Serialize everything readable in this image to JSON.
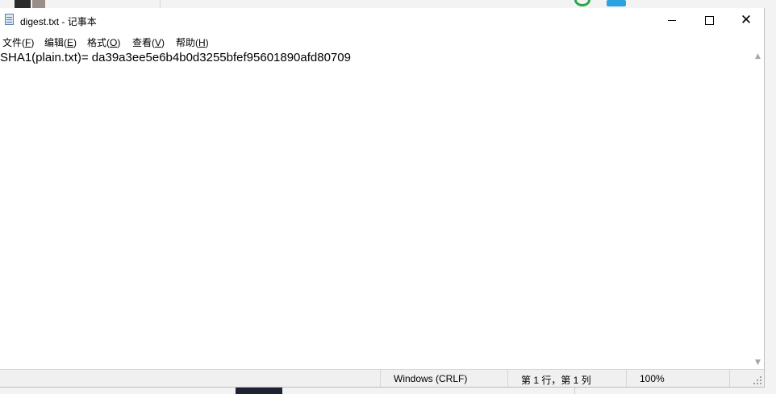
{
  "window": {
    "title": "digest.txt - 记事本",
    "minimize_glyph": "",
    "maximize_glyph": "",
    "close_glyph": "✕"
  },
  "menu": {
    "items": [
      {
        "label": "文件(",
        "accel": "F",
        "suffix": ")"
      },
      {
        "label": "编辑(",
        "accel": "E",
        "suffix": ")"
      },
      {
        "label": "格式(",
        "accel": "O",
        "suffix": ")"
      },
      {
        "label": "查看(",
        "accel": "V",
        "suffix": ")"
      },
      {
        "label": "帮助(",
        "accel": "H",
        "suffix": ")"
      }
    ]
  },
  "editor": {
    "content": "SHA1(plain.txt)= da39a3ee5e6b4b0d3255bfef95601890afd80709"
  },
  "scrollbar": {
    "up_arrow": "▲",
    "down_arrow": "▼"
  },
  "status": {
    "encoding": "Windows (CRLF)",
    "position": "第 1 行，第 1 列",
    "zoom": "100%"
  }
}
